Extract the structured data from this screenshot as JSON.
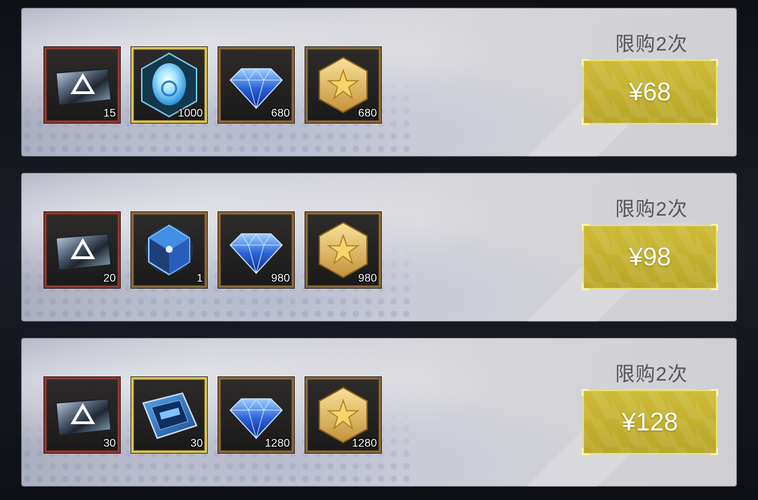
{
  "packs": [
    {
      "limit": "限购2次",
      "price": "¥68",
      "items": [
        {
          "icon": "ticket-card-icon",
          "count": "15"
        },
        {
          "icon": "crystal-orb-icon",
          "count": "1000"
        },
        {
          "icon": "blue-diamond-icon",
          "count": "680"
        },
        {
          "icon": "gold-star-coin-icon",
          "count": "680"
        }
      ]
    },
    {
      "limit": "限购2次",
      "price": "¥98",
      "items": [
        {
          "icon": "ticket-card-icon",
          "count": "20"
        },
        {
          "icon": "blue-crystal-cube-icon",
          "count": "1"
        },
        {
          "icon": "blue-diamond-icon",
          "count": "980"
        },
        {
          "icon": "gold-star-coin-icon",
          "count": "980"
        }
      ]
    },
    {
      "limit": "限购2次",
      "price": "¥128",
      "items": [
        {
          "icon": "ticket-card-icon",
          "count": "30"
        },
        {
          "icon": "chip-box-icon",
          "count": "30"
        },
        {
          "icon": "blue-diamond-icon",
          "count": "1280"
        },
        {
          "icon": "gold-star-coin-icon",
          "count": "1280"
        }
      ]
    }
  ],
  "colors": {
    "price_button": "#c4b232",
    "limit_text": "#55565c",
    "frame_red": "#8d3a32",
    "frame_bronze": "#8a6a3c",
    "frame_gold": "#d8c45a"
  }
}
